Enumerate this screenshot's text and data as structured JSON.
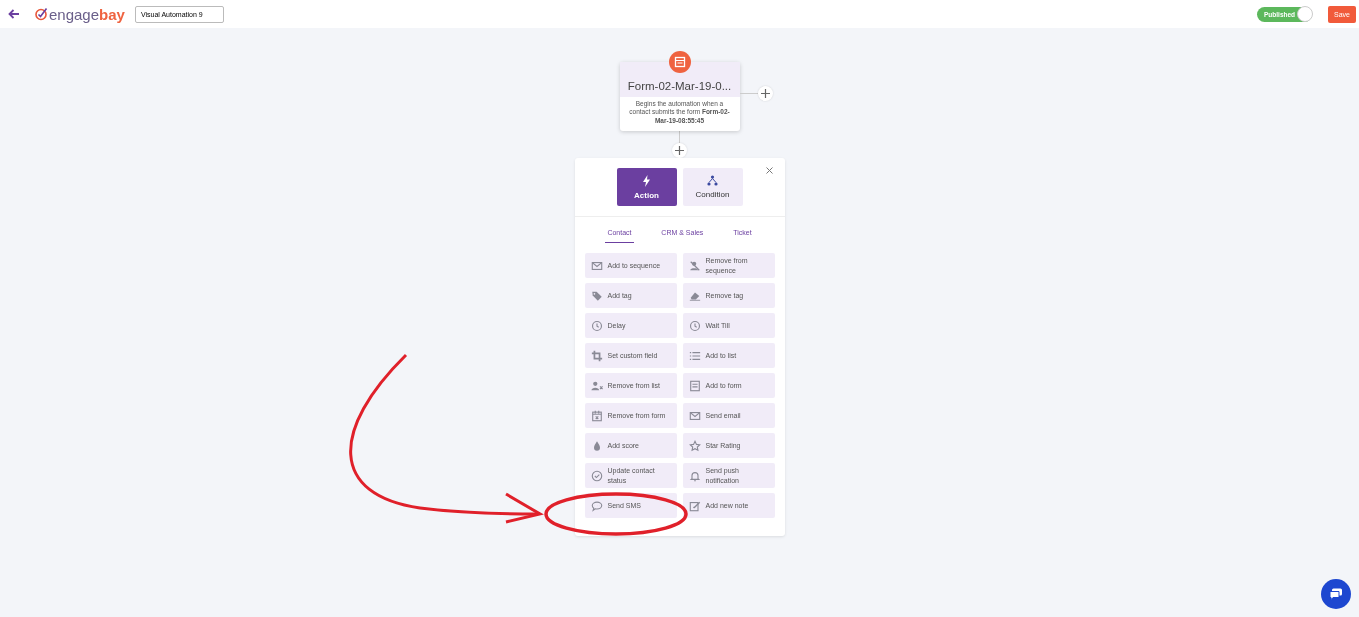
{
  "header": {
    "logo": {
      "prefix": "engage",
      "suffix": "bay"
    },
    "automation_name": "Visual Automation 9",
    "publish_toggle": {
      "label": "Published",
      "on": true
    },
    "save_button": "Save"
  },
  "trigger_node": {
    "title": "Form-02-Mar-19-0...",
    "description": "Begins the automation when a contact submits the form **Form-02-Mar-19-08:55:45**"
  },
  "picker": {
    "types": [
      {
        "label": "Action",
        "selected": true
      },
      {
        "label": "Condition",
        "selected": false
      }
    ],
    "tabs": [
      {
        "label": "Contact",
        "selected": true
      },
      {
        "label": "CRM & Sales",
        "selected": false
      },
      {
        "label": "Ticket",
        "selected": false
      }
    ],
    "action_rows": [
      [
        "Add to sequence",
        "Remove from sequence"
      ],
      [
        "Add tag",
        "Remove tag"
      ],
      [
        "Delay",
        "Wait Till"
      ],
      [
        "Set custom field",
        "Add to list"
      ],
      [
        "Remove from list",
        "Add to form"
      ],
      [
        "Remove from form",
        "Send email"
      ],
      [
        "Add score",
        "Star Rating"
      ],
      [
        "Update contact status",
        "Send push notification"
      ],
      [
        "Send SMS",
        "Add new note"
      ]
    ]
  }
}
